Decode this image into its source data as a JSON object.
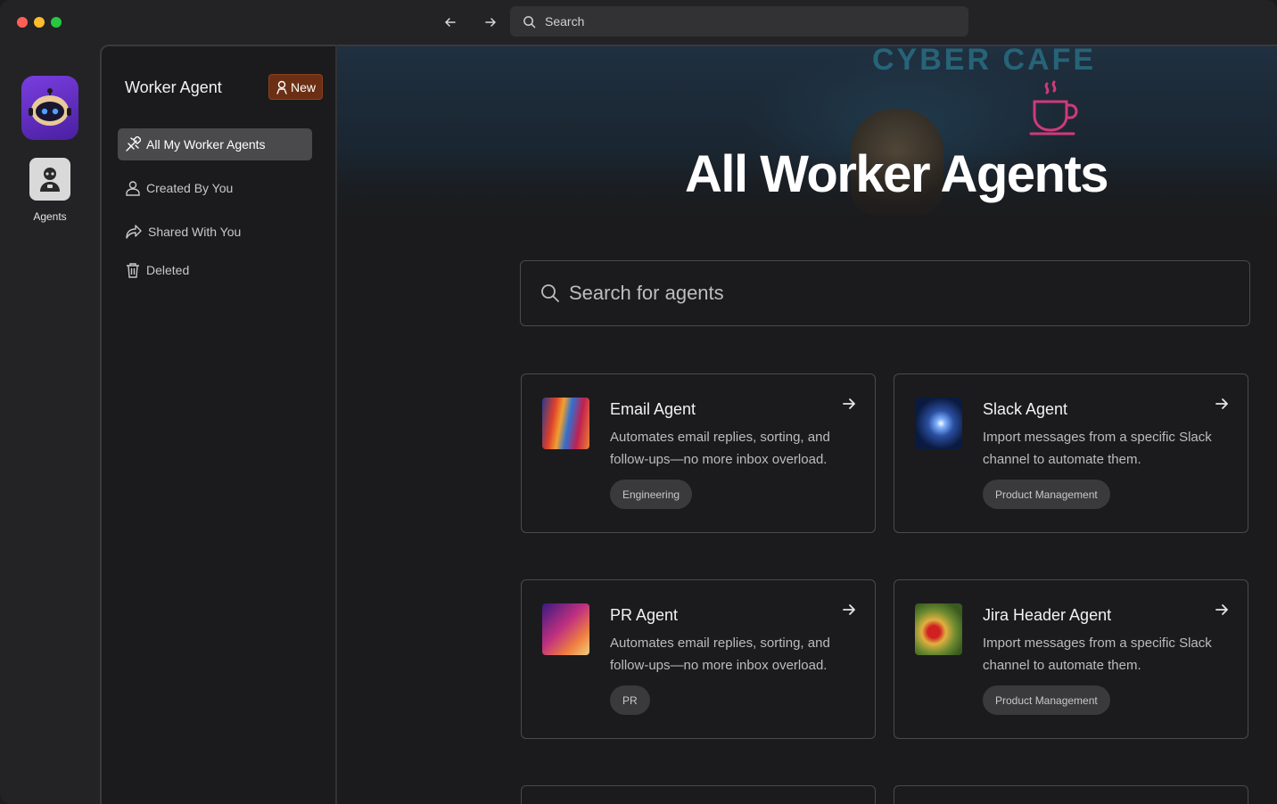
{
  "topbar": {
    "search_label": "Search"
  },
  "rail": {
    "agents_label": "Agents"
  },
  "sidebar": {
    "title": "Worker Agent",
    "new_label": "New",
    "items": [
      {
        "label": "All My Worker Agents",
        "icon": "magic-wand-icon",
        "active": true
      },
      {
        "label": "Created By You",
        "icon": "person-icon",
        "active": false
      },
      {
        "label": "Shared With You",
        "icon": "share-arrow-icon",
        "active": false
      },
      {
        "label": "Deleted",
        "icon": "trash-icon",
        "active": false
      }
    ]
  },
  "main": {
    "hero_title": "All Worker Agents",
    "hero_sign": "CYBER CAFE",
    "search_placeholder": "Search for agents",
    "cards": [
      {
        "title": "Email Agent",
        "description": "Automates email replies, sorting, and follow-ups—no more inbox overload.",
        "tag": "Engineering"
      },
      {
        "title": "Slack Agent",
        "description": "Import messages from a specific Slack channel to automate them.",
        "tag": "Product Management"
      },
      {
        "title": "PR Agent",
        "description": "Automates email replies, sorting, and follow-ups—no more inbox overload.",
        "tag": "PR"
      },
      {
        "title": "Jira Header Agent",
        "description": "Import messages from a specific Slack channel to automate them.",
        "tag": "Product Management"
      }
    ]
  },
  "colors": {
    "new_badge_bg": "#6b2f14",
    "active_item_bg": "#4a4a4d",
    "logo_purple": "#7a3ee0"
  }
}
